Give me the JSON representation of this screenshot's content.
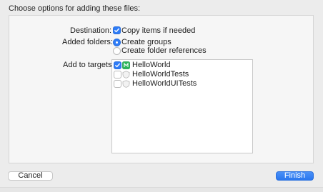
{
  "header": {
    "title": "Choose options for adding these files:"
  },
  "destination": {
    "label": "Destination:",
    "option_label": "Copy items if needed",
    "checked": true
  },
  "added_folders": {
    "label": "Added folders:",
    "options": [
      {
        "label": "Create groups",
        "selected": true
      },
      {
        "label": "Create folder references",
        "selected": false
      }
    ]
  },
  "targets": {
    "label": "Add to targets:",
    "items": [
      {
        "label": "HelloWorld",
        "checked": true,
        "icon": "app-target-icon"
      },
      {
        "label": "HelloWorldTests",
        "checked": false,
        "icon": "test-target-icon"
      },
      {
        "label": "HelloWorldUITests",
        "checked": false,
        "icon": "test-target-icon"
      }
    ]
  },
  "buttons": {
    "cancel": "Cancel",
    "finish": "Finish"
  },
  "colors": {
    "accent": "#2f7cf6",
    "background": "#ececec",
    "panel": "#f6f6f6"
  }
}
